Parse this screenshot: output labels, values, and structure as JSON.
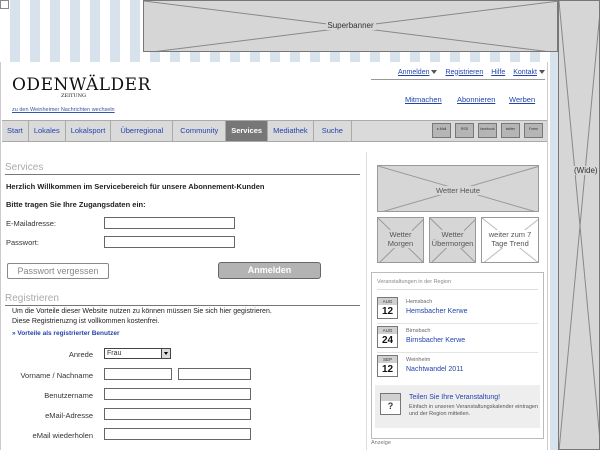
{
  "ads": {
    "superbanner": "Superbanner",
    "skyscraper": "(Wide) S"
  },
  "header": {
    "logo_title": "ODENWÄLDER",
    "logo_subtitle": "ZEITUNG",
    "switch_link": "zu den Weinheimer Nachrichten wechseln",
    "top_links": [
      "Anmelden",
      "Registrieren",
      "Hilfe",
      "Kontakt"
    ],
    "right_links": [
      "Mitmachen",
      "Abonnieren",
      "Werben"
    ]
  },
  "nav": {
    "tabs": [
      "Start",
      "Lokales",
      "Lokalsport",
      "Überregional",
      "Community",
      "Services",
      "Mediathek",
      "Suche"
    ],
    "active": "Services",
    "icons": [
      "e-Mail",
      "RSS",
      "facebook",
      "twitter",
      "Foren"
    ]
  },
  "services": {
    "heading": "Services",
    "welcome": "Herzlich Willkommen im Servicebereich für unsere Abonnement-Kunden",
    "prompt": "Bitte tragen Sie Ihre Zugangsdaten ein:",
    "email_label": "E-Mailadresse:",
    "password_label": "Passwort:",
    "forgot_button": "Passwort vergessen",
    "login_button": "Anmelden"
  },
  "register": {
    "heading": "Registrieren",
    "intro_1": "Um die Vorteile dieser Website nutzen zu können müssen Sie sich hier gegistrieren.",
    "intro_2": "Diese Registrieruzng ist vollkommen kostenfrei.",
    "benefits_link": "» Vorteile als registrierter Benutzer",
    "anrede_label": "Anrede",
    "anrede_value": "Frau",
    "name_label": "Vorname / Nachname",
    "user_label": "Benutzername",
    "email_label": "eMail-Adresse",
    "email_repeat_label": "eMail wiederholen"
  },
  "weather": {
    "today": "Wetter Heute",
    "tomorrow_1": "Wetter",
    "tomorrow_2": "Morgen",
    "dayafter_1": "Wetter",
    "dayafter_2": "Übermorgen",
    "trend_1": "weiter zum 7",
    "trend_2": "Tage Trend"
  },
  "events": {
    "title": "Veranstaltungen in der Region",
    "items": [
      {
        "month": "AUG",
        "day": "12",
        "place": "Hemsbach",
        "name": "Hemsbacher Kerwe"
      },
      {
        "month": "AUG",
        "day": "24",
        "place": "Birnsbach",
        "name": "Birnsbacher Kerwe"
      },
      {
        "month": "SEP",
        "day": "12",
        "place": "Weinheim",
        "name": "Nachtwandel 2011"
      }
    ],
    "share_icon": "?",
    "share_title": "Teilen Sie Ihre Veranstaltung!",
    "share_text": "Einfach in unseren Veranstaltungskalender eintragen und der Region mitteilen."
  },
  "footer": {
    "anzeige": "Anzeige"
  }
}
